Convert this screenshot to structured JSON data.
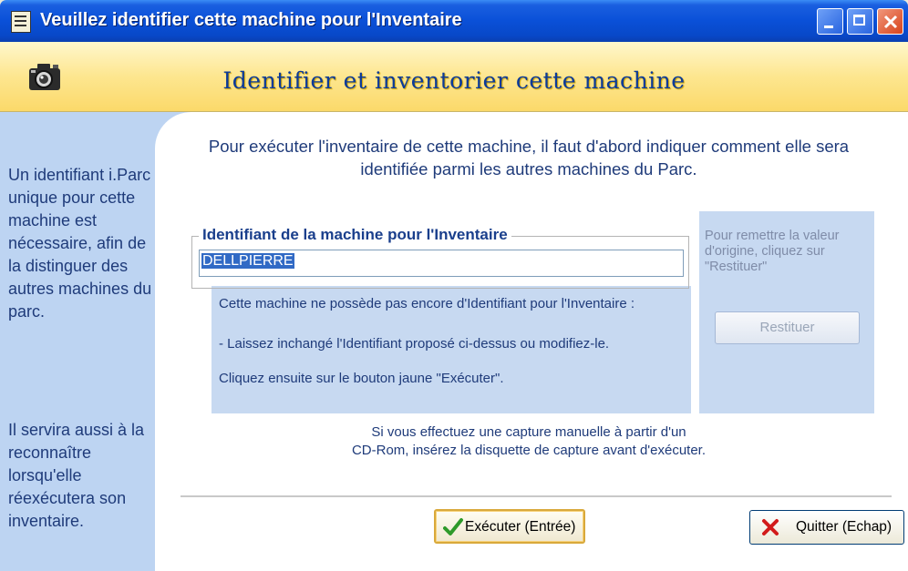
{
  "window": {
    "title": "Veuillez identifier cette machine pour l'Inventaire",
    "controls": [
      "minimize-icon",
      "maximize-icon",
      "close-icon"
    ]
  },
  "banner": {
    "title": "Identifier et inventorier cette machine",
    "icon": "camera-icon"
  },
  "sidebar": {
    "paragraph1": "Un identifiant i.Parc unique pour cette machine est nécessaire, afin de la distinguer des autres machines du parc.",
    "paragraph2": "Il servira aussi à la reconnaître lorsqu'elle réexécutera son inventaire."
  },
  "main": {
    "intro": "Pour exécuter l'inventaire de cette machine, il faut d'abord indiquer comment elle sera identifiée parmi les autres machines du Parc.",
    "group_label": "Identifiant de la machine pour l'Inventaire",
    "identifier_value": "DELLPIERRE",
    "info_line1": "Cette machine ne possède pas encore d'Identifiant pour l'Inventaire :",
    "info_line2": "- Laissez inchangé l'Identifiant proposé ci-dessus ou modifiez-le.",
    "info_line3": "Cliquez ensuite sur le bouton jaune \"Exécuter\".",
    "restore_hint": "Pour remettre la valeur d'origine, cliquez sur \"Restituer\"",
    "restore_label": "Restituer",
    "capture_note_line1": "Si vous effectuez une capture manuelle à partir d'un",
    "capture_note_line2": "CD-Rom, insérez la disquette de capture avant d'exécuter."
  },
  "buttons": {
    "execute_label": "Exécuter (Entrée)",
    "quit_label": "Quitter (Echap)"
  },
  "colors": {
    "title_bar": "#0a50d8",
    "banner": "#fde68f",
    "sidebar": "#bdd4f2",
    "accent_text": "#1f3b7a",
    "execute_border": "#d9a93b"
  }
}
